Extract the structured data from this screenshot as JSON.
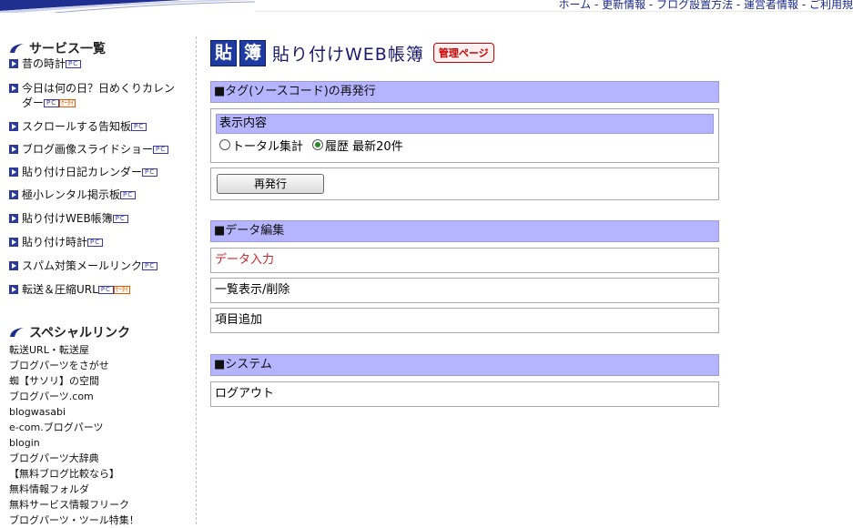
{
  "topnav": "ホーム - 更新情報 - ブログ設置方法 - 運営者情報 - ご利用規",
  "sidebar": {
    "services_heading": "サービス一覧",
    "services": [
      {
        "label": "昔の時計",
        "pc": "PC",
        "k": ""
      },
      {
        "label": "今日は何の日？日めくりカレン",
        "label2": "ダー",
        "pc": "PC",
        "k": "ｹｰﾀｲ"
      },
      {
        "label": "スクロールする告知板",
        "pc": "PC",
        "k": ""
      },
      {
        "label": "ブログ画像スライドショー",
        "pc": "PC",
        "k": ""
      },
      {
        "label": "貼り付け日記カレンダー",
        "pc": "PC",
        "k": ""
      },
      {
        "label": "極小レンタル掲示板",
        "pc": "PC",
        "k": ""
      },
      {
        "label": "貼り付けWEB帳簿",
        "pc": "PC",
        "k": ""
      },
      {
        "label": "貼り付け時計",
        "pc": "PC",
        "k": ""
      },
      {
        "label": "スパム対策メールリンク",
        "pc": "PC",
        "k": ""
      },
      {
        "label": "転送＆圧縮URL",
        "pc": "PC",
        "k": "ｹｰﾀｲ"
      }
    ],
    "special_heading": "スペシャルリンク",
    "special_links": [
      "転送URL・転送屋",
      "ブログパーツをさがせ",
      "蜘【サソリ】の空間",
      "ブログパーツ.com",
      "blogwasabi",
      "e-com.ブログパーツ",
      "blogin",
      "ブログパーツ大辞典",
      "【無料ブログ比較なら】",
      "無料情報フォルダ",
      "無料サービス情報フリーク",
      "ブログパーツ・ツール特集！"
    ]
  },
  "header": {
    "kanji1": "貼",
    "kanji2": "簿",
    "title": "貼り付けWEB帳簿",
    "badge": "管理ページ"
  },
  "tag_section": {
    "heading": "■タグ(ソースコード)の再発行",
    "display_label": "表示内容",
    "radio_total": "トータル集計",
    "radio_history": "履歴 最新20件",
    "selected": "history",
    "reissue_button": "再発行"
  },
  "data_section": {
    "heading": "■データ編集",
    "input_link": "データ入力",
    "input_link_color": "#c0262a",
    "list_link": "一覧表示/削除",
    "add_link": "項目追加"
  },
  "system_section": {
    "heading": "■システム",
    "logout_link": "ログアウト"
  }
}
